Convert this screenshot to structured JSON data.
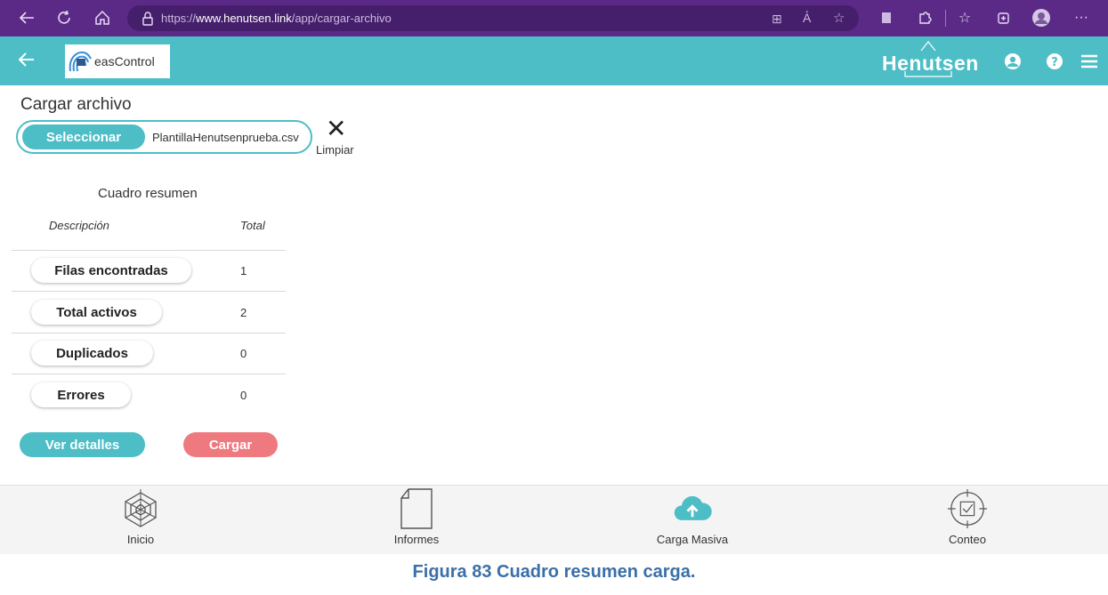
{
  "browser": {
    "url_prefix": "https://",
    "url_host": "www.henutsen.link",
    "url_path": "/app/cargar-archivo",
    "icons": [
      "back-arrow-icon",
      "refresh-icon",
      "home-icon",
      "lock-icon",
      "grid-icon",
      "read-aloud-icon",
      "favorite-star-icon",
      "extension-icon",
      "puzzle-icon",
      "favorites-icon",
      "collections-icon",
      "profile-icon",
      "more-icon"
    ]
  },
  "header": {
    "logo_text": "easControl",
    "brand": "Henutsen",
    "icons": [
      "back-arrow-icon",
      "user-icon",
      "help-icon",
      "menu-icon"
    ]
  },
  "page": {
    "title": "Cargar archivo",
    "select_label": "Seleccionar",
    "file_name": "PlantillaHenutsenprueba.csv",
    "clear_label": "Limpiar"
  },
  "summary": {
    "title": "Cuadro resumen",
    "col_description": "Descripción",
    "col_total": "Total",
    "rows": [
      {
        "label": "Filas encontradas",
        "value": "1"
      },
      {
        "label": "Total activos",
        "value": "2"
      },
      {
        "label": "Duplicados",
        "value": "0"
      },
      {
        "label": "Errores",
        "value": "0"
      }
    ]
  },
  "actions": {
    "details_label": "Ver detalles",
    "load_label": "Cargar"
  },
  "nav": {
    "items": [
      {
        "label": "Inicio"
      },
      {
        "label": "Informes"
      },
      {
        "label": "Carga Masiva"
      },
      {
        "label": "Conteo"
      }
    ]
  },
  "caption": "Figura 83 Cuadro resumen carga.",
  "colors": {
    "accent": "#4dbdc6",
    "danger": "#ee7a7f",
    "browser": "#5b2a86",
    "caption": "#3a6fa8"
  }
}
